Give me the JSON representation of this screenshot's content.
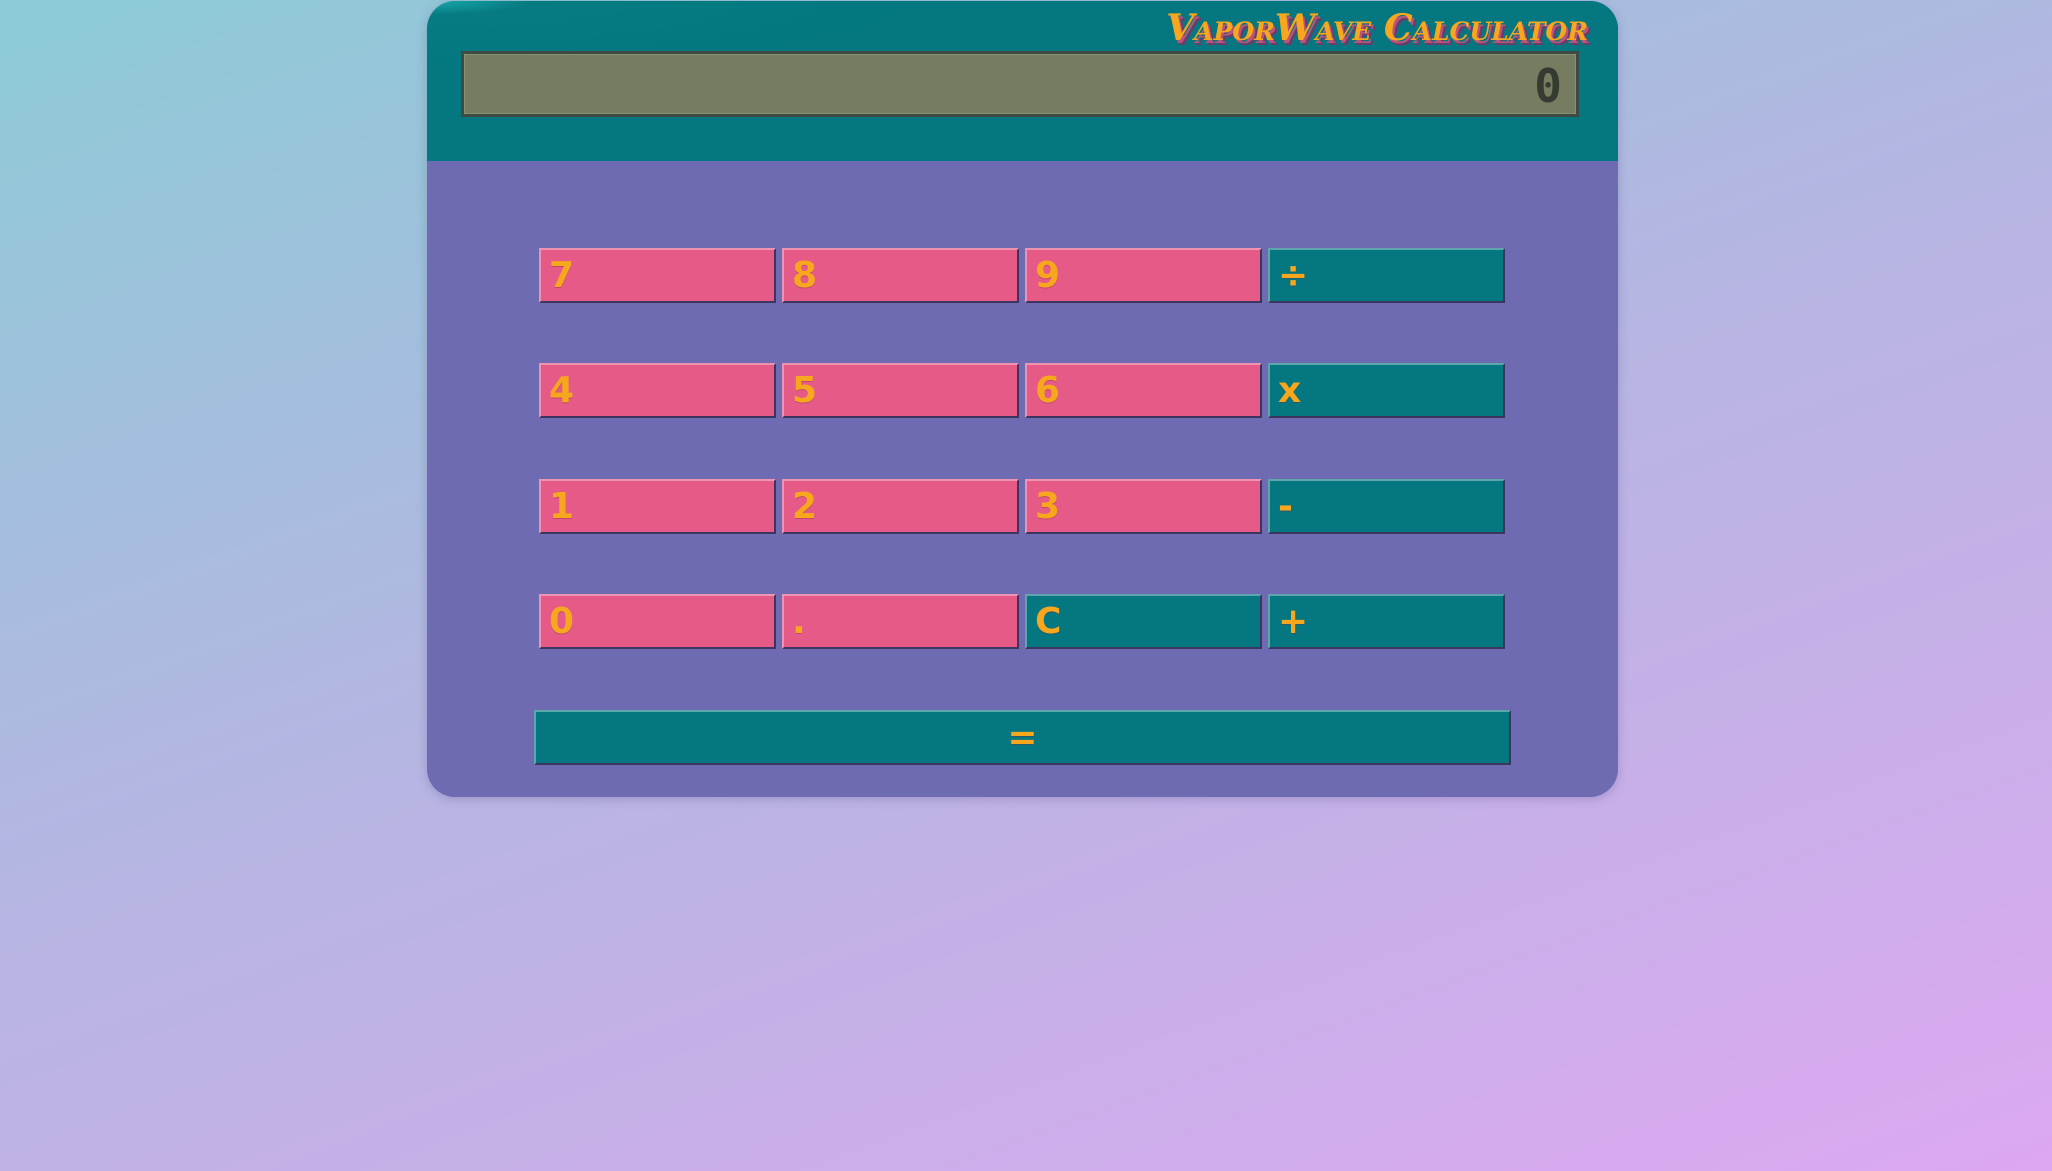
{
  "app": {
    "title": "VaporWave Calculator"
  },
  "display": {
    "value": "0"
  },
  "keys": {
    "k7": "7",
    "k8": "8",
    "k9": "9",
    "divide": "÷",
    "k4": "4",
    "k5": "5",
    "k6": "6",
    "multiply": "x",
    "k1": "1",
    "k2": "2",
    "k3": "3",
    "subtract": "-",
    "k0": "0",
    "decimal": ".",
    "clear": "C",
    "add": "+",
    "equals": "="
  },
  "colors": {
    "background_start": "#8ccbd6",
    "background_end": "#dca8f0",
    "header": "#047780",
    "body": "#6e6bb2",
    "number_key": "#e65a87",
    "operator_key": "#047780",
    "key_text": "#f6a71e",
    "display_bg": "#767c60",
    "display_text": "#343c32"
  }
}
